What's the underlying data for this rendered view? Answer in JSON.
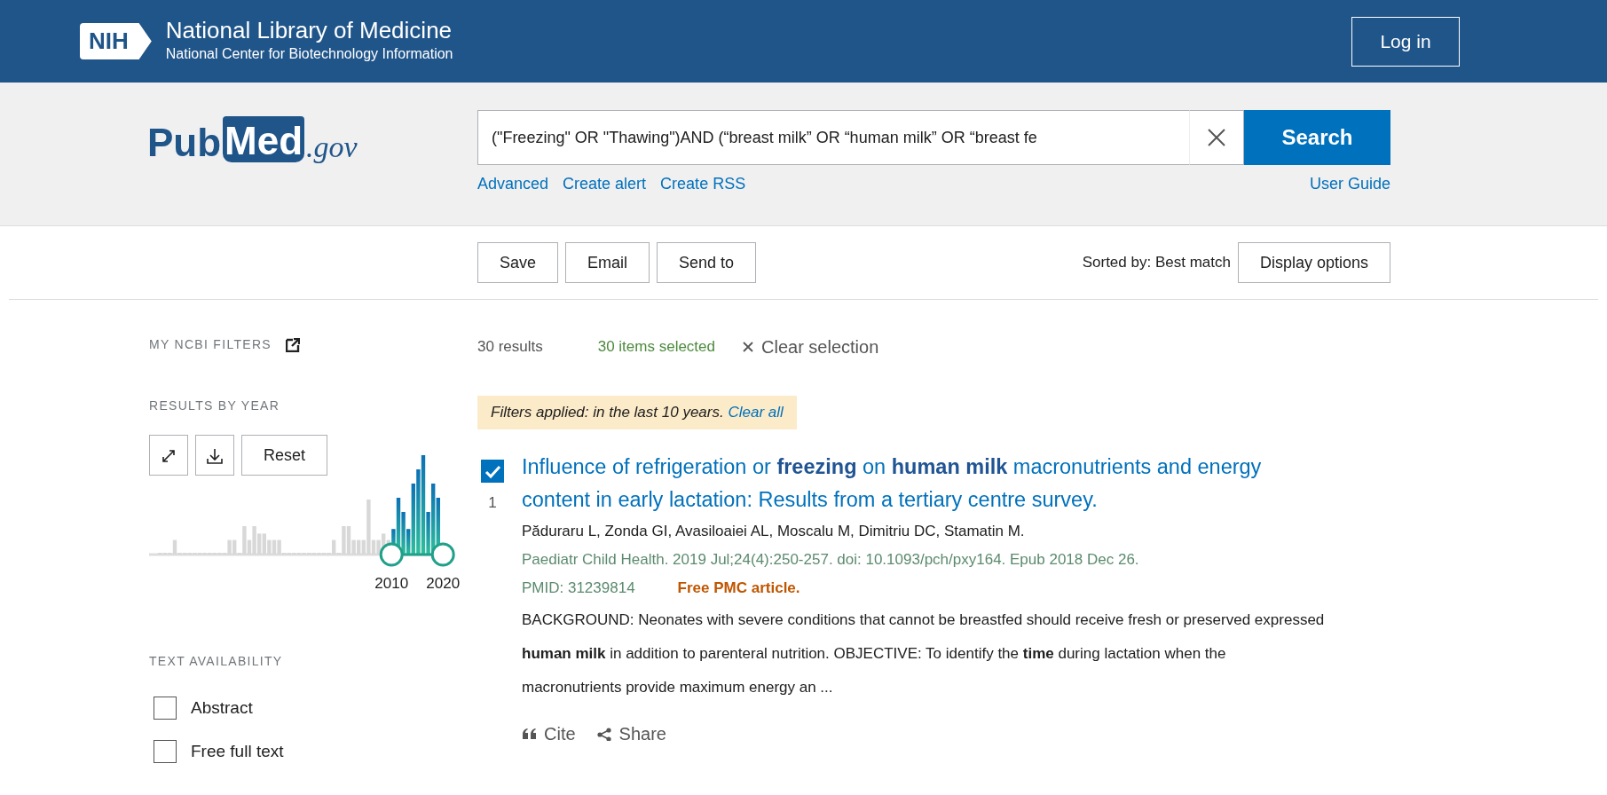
{
  "header": {
    "logo_text": "NIH",
    "title": "National Library of Medicine",
    "subtitle": "National Center for Biotechnology Information",
    "login": "Log in"
  },
  "search": {
    "logo": {
      "pub": "Pub",
      "med": "Med",
      "gov": ".gov"
    },
    "query": "(\"Freezing\" OR \"Thawing\")AND (“breast milk” OR “human milk” OR “breast fe",
    "button": "Search",
    "links": [
      "Advanced",
      "Create alert",
      "Create RSS"
    ],
    "user_guide": "User Guide"
  },
  "toolbar": {
    "buttons": [
      "Save",
      "Email",
      "Send to"
    ],
    "sorted_by": "Sorted by: Best match",
    "display_options": "Display options"
  },
  "sidebar": {
    "my_ncbi": "MY NCBI FILTERS",
    "results_by_year": "RESULTS BY YEAR",
    "reset": "Reset",
    "year_labels": [
      "2010",
      "2020"
    ],
    "text_availability": "TEXT AVAILABILITY",
    "filters": [
      {
        "label": "Abstract",
        "checked": false
      },
      {
        "label": "Free full text",
        "checked": false
      }
    ]
  },
  "results": {
    "count": "30 results",
    "selected": "30 items selected",
    "clear_selection": "Clear selection",
    "filter_note": "Filters applied: in the last 10 years.",
    "clear_all": "Clear all",
    "items": [
      {
        "checked": true,
        "number": "1",
        "title": "Influence of refrigeration or **freezing** on **human milk** macronutrients and energy content in early lactation: Results from a tertiary centre survey.",
        "authors": "Păduraru L, Zonda GI, Avasiloaiei AL, Moscalu M, Dimitriu DC, Stamatin M.",
        "citation": "Paediatr Child Health. 2019 Jul;24(4):250-257. doi: 10.1093/pch/pxy164. Epub 2018 Dec 26.",
        "pmid": "PMID: 31239814",
        "free": "Free PMC article.",
        "snippet": "BACKGROUND: Neonates with severe conditions that cannot be breastfed should receive fresh or preserved expressed **human milk** in addition to parenteral nutrition. OBJECTIVE: To identify the **time** during lactation when the macronutrients provide maximum energy an ...",
        "actions": [
          "Cite",
          "Share"
        ]
      }
    ]
  }
}
